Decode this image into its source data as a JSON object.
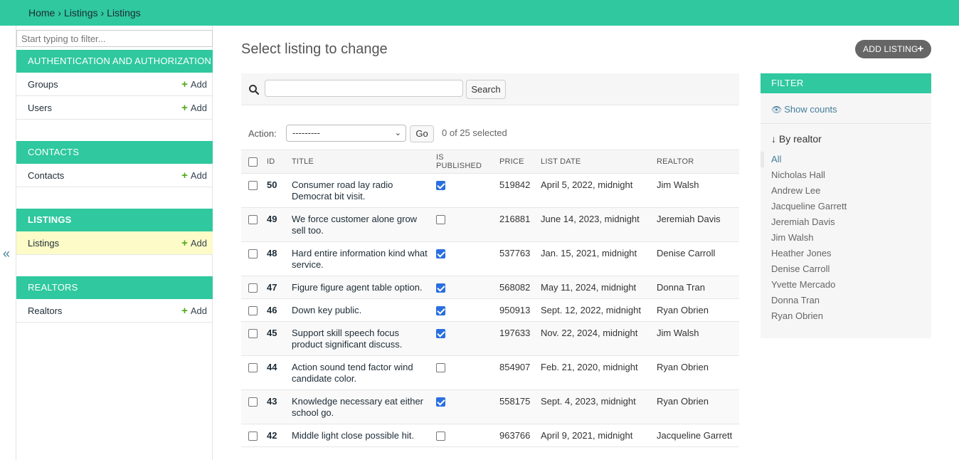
{
  "breadcrumb": {
    "home": "Home",
    "app": "Listings",
    "current": "Listings",
    "separator": "›"
  },
  "sidebar": {
    "filter_placeholder": "Start typing to filter...",
    "collapse_glyph": "«",
    "add_label": "Add",
    "apps": [
      {
        "name": "AUTHENTICATION AND AUTHORIZATION",
        "models": [
          "Groups",
          "Users"
        ]
      },
      {
        "name": "CONTACTS",
        "models": [
          "Contacts"
        ]
      },
      {
        "name": "LISTINGS",
        "models": [
          "Listings"
        ]
      },
      {
        "name": "REALTORS",
        "models": [
          "Realtors"
        ]
      }
    ]
  },
  "main": {
    "title": "Select listing to change",
    "add_button": "ADD LISTING",
    "search_button": "Search",
    "action_label": "Action:",
    "action_selected": "---------",
    "go_button": "Go",
    "selected_count": "0 of 25 selected",
    "columns": [
      "ID",
      "TITLE",
      "IS PUBLISHED",
      "PRICE",
      "LIST DATE",
      "REALTOR"
    ],
    "rows": [
      {
        "id": "50",
        "title": "Consumer road lay radio Democrat bit visit.",
        "published": true,
        "price": "519842",
        "date": "April 5, 2022, midnight",
        "realtor": "Jim Walsh"
      },
      {
        "id": "49",
        "title": "We force customer alone grow sell too.",
        "published": false,
        "price": "216881",
        "date": "June 14, 2023, midnight",
        "realtor": "Jeremiah Davis"
      },
      {
        "id": "48",
        "title": "Hard entire information kind what service.",
        "published": true,
        "price": "537763",
        "date": "Jan. 15, 2021, midnight",
        "realtor": "Denise Carroll"
      },
      {
        "id": "47",
        "title": "Figure figure agent table option.",
        "published": true,
        "price": "568082",
        "date": "May 11, 2024, midnight",
        "realtor": "Donna Tran"
      },
      {
        "id": "46",
        "title": "Down key public.",
        "published": true,
        "price": "950913",
        "date": "Sept. 12, 2022, midnight",
        "realtor": "Ryan Obrien"
      },
      {
        "id": "45",
        "title": "Support skill speech focus product significant discuss.",
        "published": true,
        "price": "197633",
        "date": "Nov. 22, 2024, midnight",
        "realtor": "Jim Walsh"
      },
      {
        "id": "44",
        "title": "Action sound tend factor wind candidate color.",
        "published": false,
        "price": "854907",
        "date": "Feb. 21, 2020, midnight",
        "realtor": "Ryan Obrien"
      },
      {
        "id": "43",
        "title": "Knowledge necessary eat either school go.",
        "published": true,
        "price": "558175",
        "date": "Sept. 4, 2023, midnight",
        "realtor": "Ryan Obrien"
      },
      {
        "id": "42",
        "title": "Middle light close possible hit.",
        "published": false,
        "price": "963766",
        "date": "April 9, 2021, midnight",
        "realtor": "Jacqueline Garrett"
      }
    ]
  },
  "filter": {
    "header": "FILTER",
    "show_counts": "Show counts",
    "by_realtor": "↓ By realtor",
    "options": [
      "All",
      "Nicholas Hall",
      "Andrew Lee",
      "Jacqueline Garrett",
      "Jeremiah Davis",
      "Jim Walsh",
      "Heather Jones",
      "Denise Carroll",
      "Yvette Mercado",
      "Donna Tran",
      "Ryan Obrien"
    ],
    "selected": "All"
  },
  "colors": {
    "accent": "#2fc89f",
    "add_plus": "#50a91c",
    "link": "#447e9b",
    "checkbox_on": "#2a6fe0",
    "active_row": "#fdfbc7"
  }
}
